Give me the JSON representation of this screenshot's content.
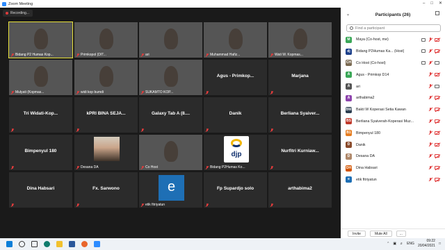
{
  "window": {
    "title": "Zoom Meeting"
  },
  "recording": {
    "label": "Recording..."
  },
  "tiles": [
    {
      "name": "",
      "caption": "Bidang P2 Humas Kop...",
      "type": "video",
      "style": "vid-room",
      "active": true
    },
    {
      "name": "",
      "caption": "Primkopol (DIT...",
      "type": "video",
      "style": "vid-office"
    },
    {
      "name": "",
      "caption": "ari",
      "type": "video",
      "style": "vid-face"
    },
    {
      "name": "",
      "caption": "Muhammad Hafiz...",
      "type": "video",
      "style": "vid-green"
    },
    {
      "name": "",
      "caption": "Wati W. Kopmas...",
      "type": "video",
      "style": "vid-hijab"
    },
    {
      "name": "",
      "caption": "Mulyati (Kopmas...",
      "type": "video",
      "style": "vid-indoor"
    },
    {
      "name": "",
      "caption": "widi kop bumdi",
      "type": "video",
      "style": "vid-window"
    },
    {
      "name": "",
      "caption": "SUKAMTO KOP...",
      "type": "video",
      "style": "vid-dark"
    },
    {
      "name": "Agus - Primkop...",
      "caption": "",
      "type": "name"
    },
    {
      "name": "Marjana",
      "caption": "",
      "type": "name"
    },
    {
      "name": "Tri Widati-Kop...",
      "caption": "",
      "type": "name"
    },
    {
      "name": "kPRI BINA SEJA...",
      "caption": "",
      "type": "name"
    },
    {
      "name": "Galaxy Tab A (8....",
      "caption": "",
      "type": "name"
    },
    {
      "name": "Danik",
      "caption": "",
      "type": "name"
    },
    {
      "name": "Berliana Syaiver...",
      "caption": "",
      "type": "name"
    },
    {
      "name": "Bimpenyul 180",
      "caption": "",
      "type": "name"
    },
    {
      "name": "",
      "caption": "Desana DA",
      "type": "face"
    },
    {
      "name": "",
      "caption": "Co Host",
      "type": "video",
      "style": "vid-group"
    },
    {
      "name": "",
      "caption": "Bidang P2Humas Ko...",
      "type": "djp"
    },
    {
      "name": "Nurfitri Kurniaw...",
      "caption": "",
      "type": "name"
    },
    {
      "name": "Dina Habsari",
      "caption": "",
      "type": "name"
    },
    {
      "name": "Fx. Sarwono",
      "caption": "",
      "type": "name"
    },
    {
      "name": "",
      "caption": "etik fitriyatun",
      "type": "letter",
      "letter": "e"
    },
    {
      "name": "Fp Supardjo solo",
      "caption": "",
      "type": "name"
    },
    {
      "name": "arthabima2",
      "caption": "",
      "type": "name"
    }
  ],
  "djp_logo_text": "djp",
  "participants": {
    "title": "Participants (26)",
    "search_placeholder": "Find a participant",
    "list": [
      {
        "initial": "M",
        "name": "Maya (Co-host, me)",
        "color": "#3aa757",
        "icons": [
          "share",
          "mic",
          "cam"
        ]
      },
      {
        "initial": "dj",
        "name": "Bidang P2Humas Ka... (Host)",
        "color": "#1b3f8a",
        "icons": [
          "share",
          "mic",
          "cam"
        ]
      },
      {
        "initial": "CH",
        "name": "Co Host (Co-host)",
        "color": "#7a6a52",
        "icons": [
          "share",
          "mic",
          "cam-on"
        ]
      },
      {
        "initial": "A",
        "name": "Agus - Primkop D14",
        "color": "#3aa757",
        "icons": [
          "mic",
          "cam"
        ]
      },
      {
        "initial": "A",
        "name": "ari",
        "color": "#555555",
        "icons": [
          "mic",
          "cam-on"
        ]
      },
      {
        "initial": "A",
        "name": "arthabima2",
        "color": "#8e44ad",
        "icons": [
          "mic",
          "cam"
        ]
      },
      {
        "initial": "BW",
        "name": "Bakti W Koperasi Setia Kawan",
        "color": "#2c3e50",
        "icons": [
          "mic",
          "cam"
        ]
      },
      {
        "initial": "BS",
        "name": "Berliana Syaiverah-Koperasi Muz...",
        "color": "#c0392b",
        "icons": [
          "mic",
          "cam"
        ]
      },
      {
        "initial": "B1",
        "name": "Bimpenyul 180",
        "color": "#e67e22",
        "icons": [
          "mic",
          "cam"
        ]
      },
      {
        "initial": "D",
        "name": "Danik",
        "color": "#8a4b2b",
        "icons": [
          "mic",
          "cam"
        ]
      },
      {
        "initial": "D",
        "name": "Desana DA",
        "color": "#b0896b",
        "icons": [
          "mic",
          "cam"
        ]
      },
      {
        "initial": "DH",
        "name": "Dina Habsari",
        "color": "#d35400",
        "icons": [
          "mic",
          "cam"
        ]
      },
      {
        "initial": "e",
        "name": "etik fitriyatun",
        "color": "#1e6fb5",
        "icons": [
          "mic",
          "cam"
        ]
      }
    ],
    "invite_label": "Invite",
    "mute_all_label": "Mute All",
    "more_label": "..."
  },
  "taskbar": {
    "time": "09:22",
    "date": "20/04/2021",
    "lang": "ENG"
  }
}
